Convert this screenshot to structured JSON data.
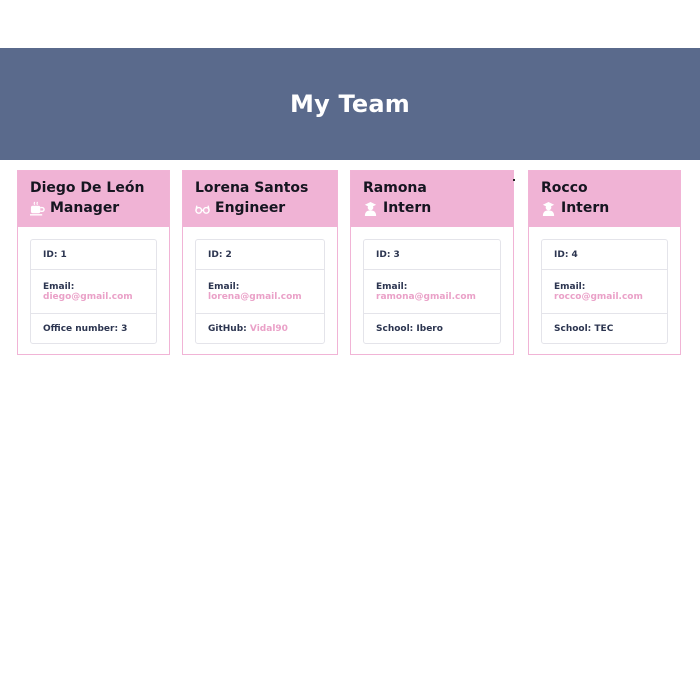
{
  "header": {
    "title": "My Team"
  },
  "cards": [
    {
      "name": "Diego De León",
      "role": "Manager",
      "role_icon": "coffee-cup-icon",
      "id_label": "ID: 1",
      "email_label": "Email:",
      "email": "diego@gmail.com",
      "extra_label": "Office number: 3",
      "extra_link": ""
    },
    {
      "name": "Lorena Santos",
      "role": "Engineer",
      "role_icon": "glasses-icon",
      "id_label": "ID: 2",
      "email_label": "Email:",
      "email": "lorena@gmail.com",
      "extra_label": "GitHub:",
      "extra_link": "Vidal90"
    },
    {
      "name": "Ramona",
      "role": "Intern",
      "role_icon": "graduate-icon",
      "id_label": "ID: 3",
      "email_label": "Email:",
      "email": "ramona@gmail.com",
      "extra_label": "School: Ibero",
      "extra_link": ""
    },
    {
      "name": "Rocco",
      "role": "Intern",
      "role_icon": "graduate-icon",
      "id_label": "ID: 4",
      "email_label": "Email:",
      "email": "rocco@gmail.com",
      "extra_label": "School: TEC",
      "extra_link": ""
    }
  ],
  "colors": {
    "header_bg": "#5a6a8c",
    "card_head_bg": "#f0b3d5",
    "link": "#eaa1c8",
    "text": "#2c3550"
  }
}
